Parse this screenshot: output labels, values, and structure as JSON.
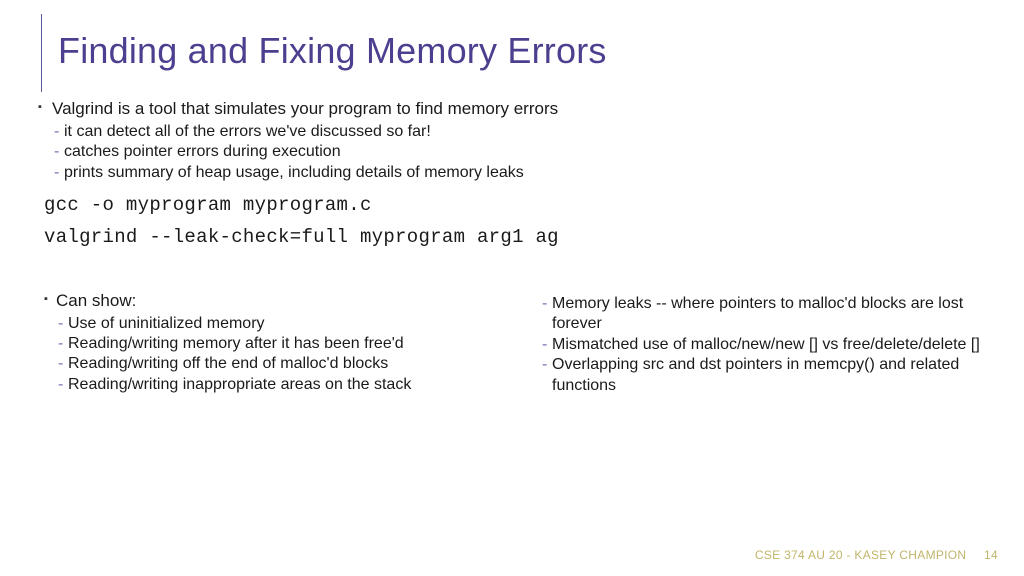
{
  "title": "Finding and Fixing Memory Errors",
  "intro": {
    "lead": "Valgrind is a tool that simulates your program to find memory errors",
    "subs": [
      "it can detect all of the errors we've discussed so far!",
      "catches pointer errors during execution",
      "prints summary of heap usage, including details of memory leaks"
    ]
  },
  "codeLines": [
    "gcc -o myprogram myprogram.c",
    "valgrind --leak-check=full myprogram arg1 ag"
  ],
  "columns": {
    "left": {
      "lead": "Can show:",
      "subs": [
        "Use of uninitialized memory",
        "Reading/writing memory after it has been free'd",
        "Reading/writing off the end of malloc'd blocks",
        "Reading/writing inappropriate areas on the stack"
      ]
    },
    "right": {
      "subs": [
        "Memory leaks -- where pointers to malloc'd blocks are lost forever",
        "Mismatched use of malloc/new/new [] vs free/delete/delete []",
        "Overlapping src and dst pointers in memcpy() and related functions"
      ]
    }
  },
  "footer": {
    "course": "CSE 374 AU 20 - KASEY CHAMPION",
    "page": "14"
  }
}
